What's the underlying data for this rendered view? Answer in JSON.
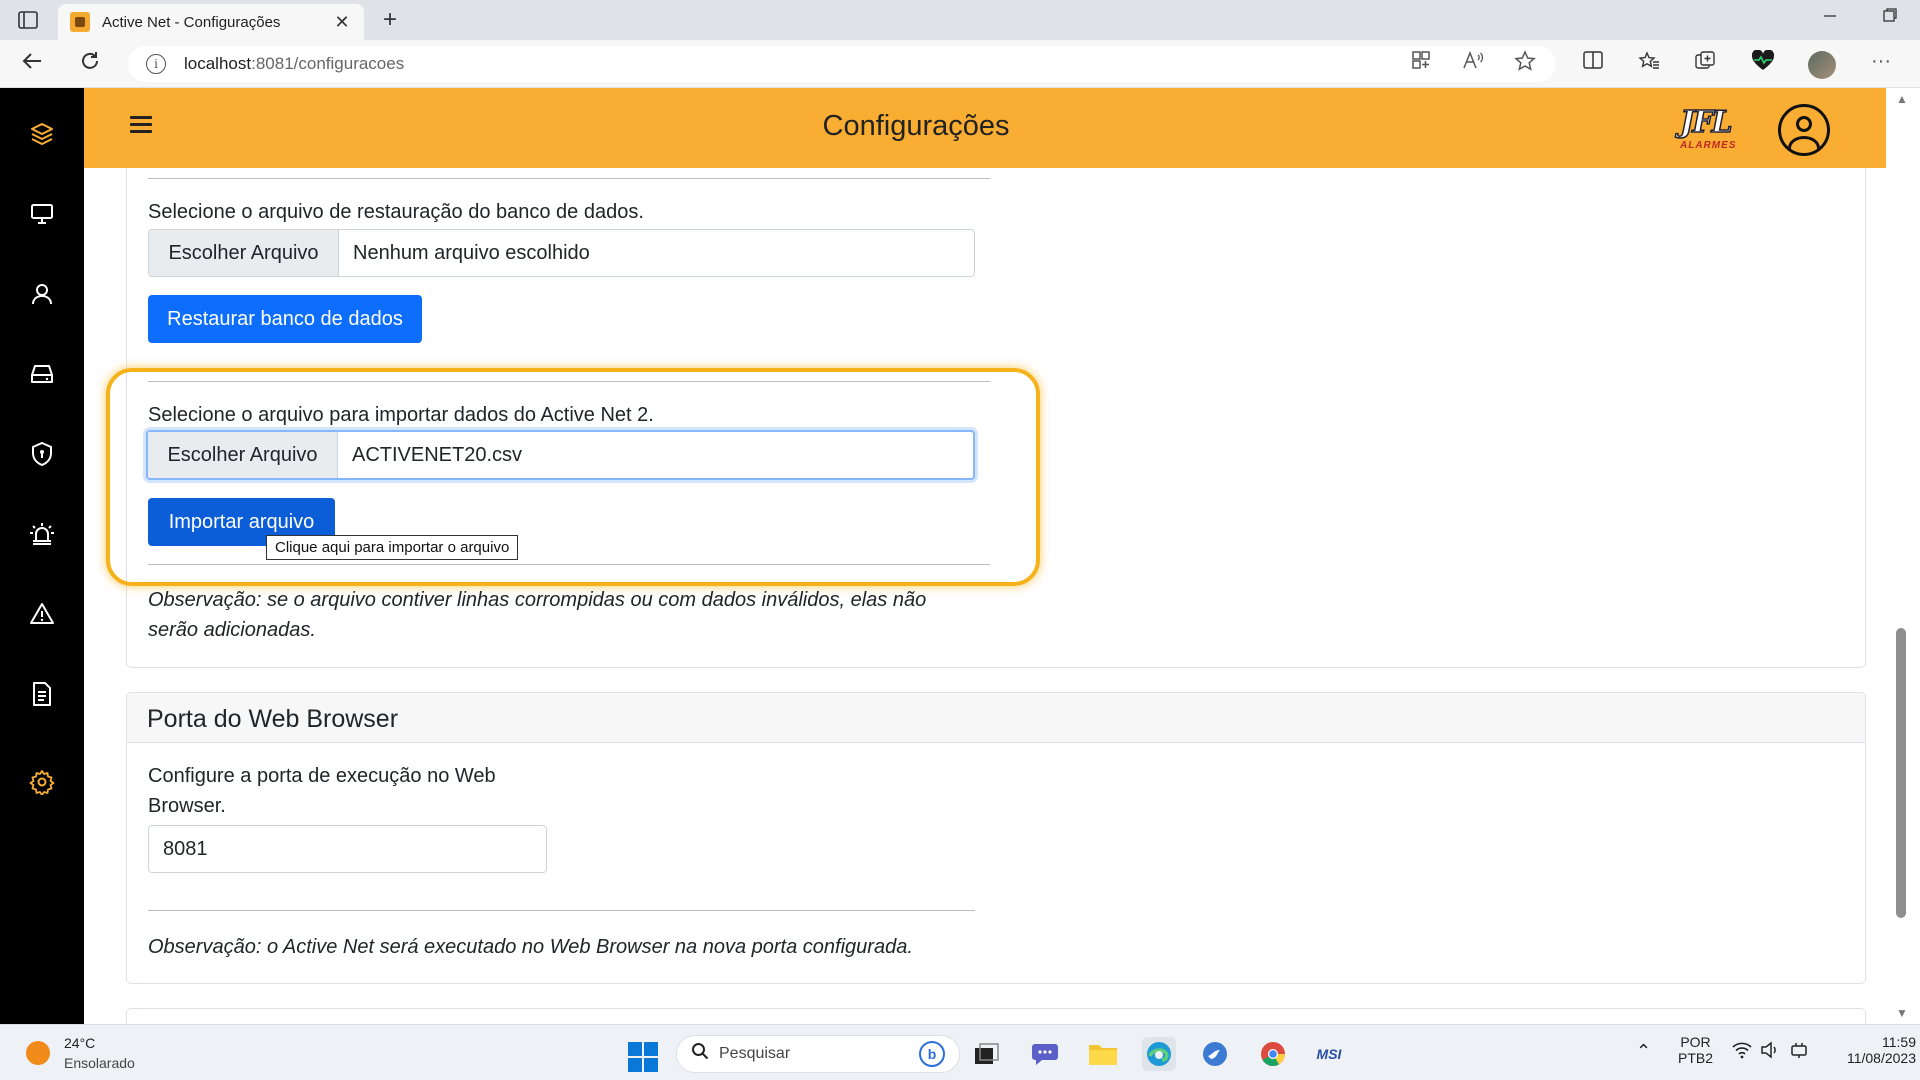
{
  "browser": {
    "tab_title": "Active Net - Configurações",
    "close_symbol": "✕",
    "new_tab_symbol": "+",
    "url_host": "localhost",
    "url_rest": ":8081/configuracoes",
    "info_symbol": "i",
    "more_symbol": "···"
  },
  "header": {
    "title": "Configurações",
    "logo_text": "JFL",
    "logo_sub": "ALARMES",
    "accent_color": "#f9ae33"
  },
  "sidebar": {
    "items": [
      {
        "icon": "layers-icon"
      },
      {
        "icon": "monitor-icon"
      },
      {
        "icon": "user-icon"
      },
      {
        "icon": "inbox-icon"
      },
      {
        "icon": "shield-icon"
      },
      {
        "icon": "siren-icon"
      },
      {
        "icon": "warning-icon"
      },
      {
        "icon": "document-icon"
      },
      {
        "icon": "gear-icon",
        "active": true
      }
    ]
  },
  "restore": {
    "label": "Selecione o arquivo de restauração do banco de dados.",
    "file_button": "Escolher Arquivo",
    "file_name": "Nenhum arquivo escolhido",
    "button": "Restaurar banco de dados"
  },
  "import": {
    "label": "Selecione o arquivo para importar dados do Active Net 2.",
    "file_button": "Escolher Arquivo",
    "file_name": "ACTIVENET20.csv",
    "button": "Importar arquivo",
    "tooltip": "Clique aqui para importar o arquivo",
    "note_line1": "Observação: se o arquivo contiver linhas corrompidas ou com dados inválidos, elas não",
    "note_line2": "serão adicionadas."
  },
  "web_port": {
    "title": "Porta do Web Browser",
    "label_line1": "Configure a porta de execução no Web",
    "label_line2": "Browser.",
    "value": "8081",
    "note": "Observação: o Active Net será executado no Web Browser na nova porta configurada."
  },
  "taskbar": {
    "temperature": "24°C",
    "weather": "Ensolarado",
    "search_placeholder": "Pesquisar",
    "lang_top": "POR",
    "lang_bottom": "PTB2",
    "time": "11:59",
    "date": "11/08/2023",
    "msi_label": "MSI"
  }
}
